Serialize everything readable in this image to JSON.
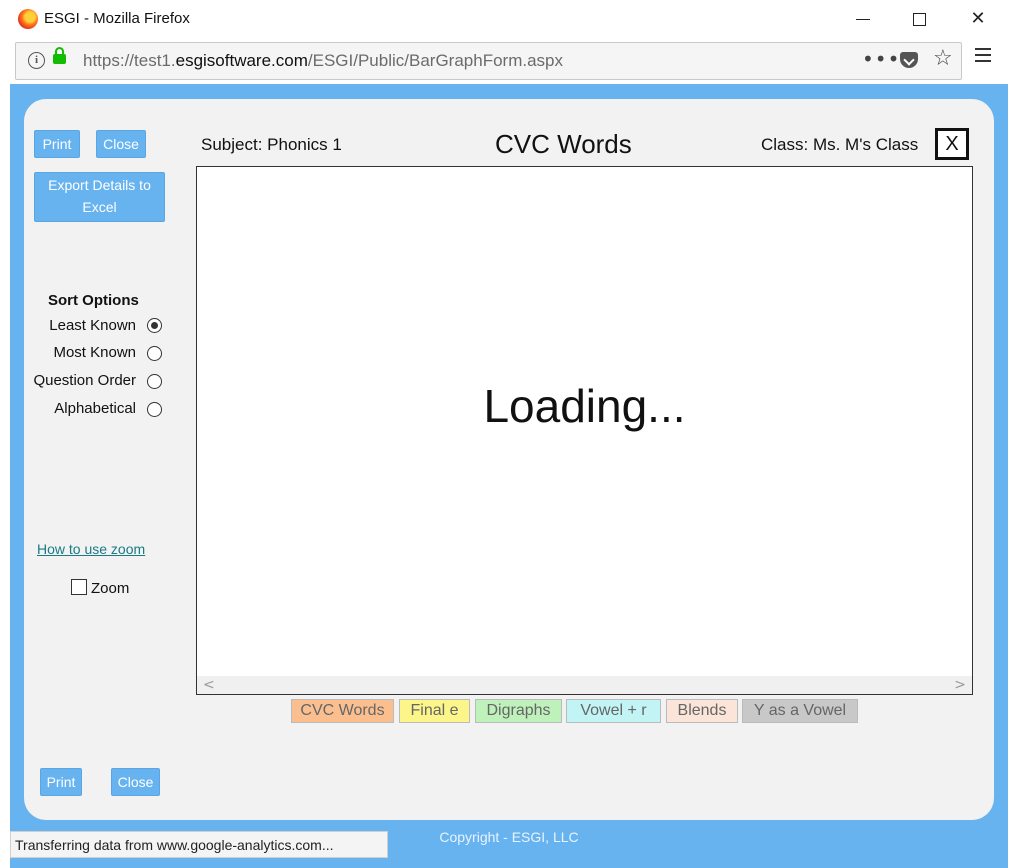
{
  "window": {
    "title": "ESGI - Mozilla Firefox",
    "url_prefix": "https://test1.",
    "url_domain": "esgisoftware.com",
    "url_path": "/ESGI/Public/BarGraphForm.aspx",
    "icons": [
      "firefox-logo-icon",
      "minimize-icon",
      "maximize-icon",
      "close-icon",
      "info-icon",
      "lock-icon",
      "more-icon",
      "pocket-icon",
      "bookmark-star-icon",
      "hamburger-menu-icon"
    ]
  },
  "sidebar": {
    "print_label": "Print",
    "close_label": "Close",
    "export_label": "Export Details to Excel",
    "sort_title": "Sort Options",
    "sort_options": [
      {
        "label": "Least Known",
        "selected": true
      },
      {
        "label": "Most Known",
        "selected": false
      },
      {
        "label": "Question Order",
        "selected": false
      },
      {
        "label": "Alphabetical",
        "selected": false
      }
    ],
    "zoom_link": "How to use zoom",
    "zoom_label": "Zoom",
    "zoom_checked": false,
    "bottom_print_label": "Print",
    "bottom_close_label": "Close"
  },
  "header": {
    "subject": "Subject: Phonics 1",
    "title": "CVC Words",
    "class_label": "Class: Ms. M's Class",
    "close_x": "X"
  },
  "chart": {
    "loading_text": "Loading...",
    "scroll_left": "<",
    "scroll_right": ">"
  },
  "tabs": [
    {
      "label": "CVC Words",
      "color": "#fbbf8f"
    },
    {
      "label": "Final e",
      "color": "#fbf58a"
    },
    {
      "label": "Digraphs",
      "color": "#bff2bb"
    },
    {
      "label": "Vowel + r",
      "color": "#c2f4f6"
    },
    {
      "label": "Blends",
      "color": "#fbe5d8"
    },
    {
      "label": "Y as a Vowel",
      "color": "#c8c8c8"
    }
  ],
  "footer": {
    "copyright": "Copyright - ESGI, LLC",
    "status": "Transferring data from www.google-analytics.com..."
  },
  "colors": {
    "page_blue": "#67b3f0",
    "panel_bg": "#f2f2f2",
    "link_teal": "#1a7a85"
  }
}
